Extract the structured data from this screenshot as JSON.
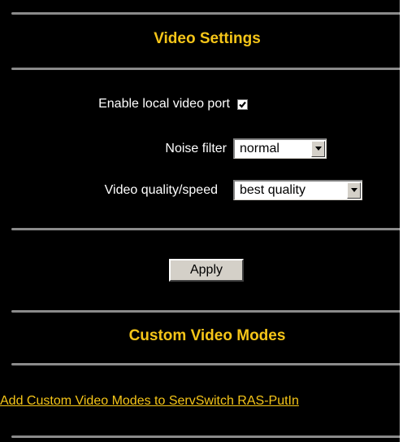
{
  "video_settings": {
    "title": "Video Settings",
    "enable_local_video_port": {
      "label": "Enable local video port",
      "checked": true
    },
    "noise_filter": {
      "label": "Noise filter",
      "value": "normal"
    },
    "video_quality": {
      "label": "Video quality/speed",
      "value": "best quality"
    },
    "apply_label": "Apply"
  },
  "custom_video_modes": {
    "title": "Custom Video Modes",
    "link_text": "Add Custom Video Modes to ServSwitch RAS-PutIn"
  },
  "colors": {
    "background": "#000000",
    "accent": "#f5c518",
    "divider": "#8a8a8a"
  }
}
